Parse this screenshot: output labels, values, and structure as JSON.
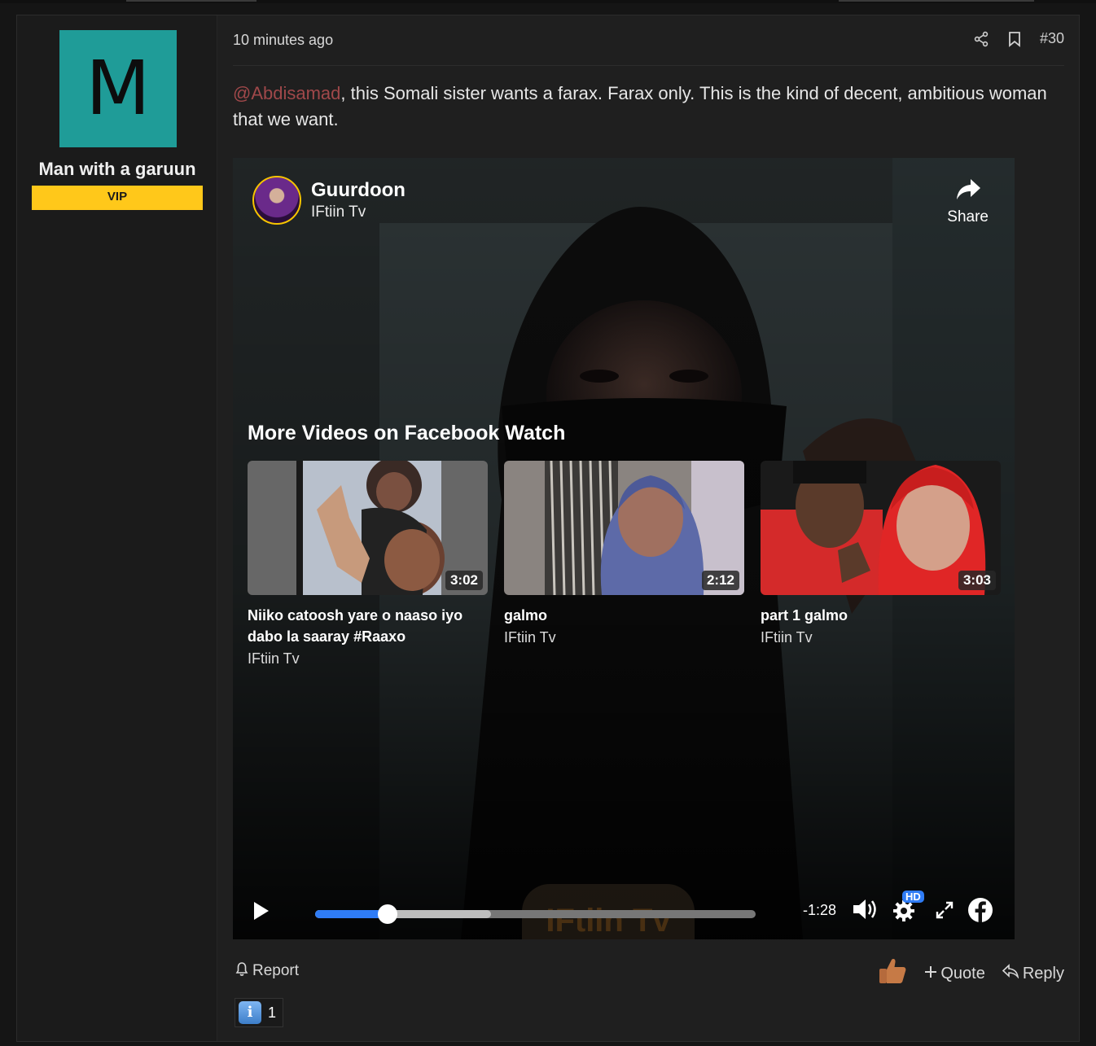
{
  "post": {
    "user": {
      "avatar_letter": "M",
      "name": "Man with a garuun",
      "badge": "VIP"
    },
    "timestamp": "10 minutes ago",
    "post_number": "#30",
    "message": {
      "mention": "@Abdisamad",
      "text": ", this Somali sister wants a farax. Farax only. This is the kind of decent, ambitious woman that we want."
    },
    "video": {
      "title": "Guurdoon",
      "page": "IFtiin Tv",
      "share_label": "Share",
      "more_videos_title": "More Videos on Facebook Watch",
      "suggested": [
        {
          "title": "Niiko catoosh yare o naaso iyo dabo la saaray #Raaxo",
          "channel": "IFtiin Tv",
          "duration": "3:02"
        },
        {
          "title": "galmo",
          "channel": "IFtiin Tv",
          "duration": "2:12"
        },
        {
          "title": "part 1 galmo",
          "channel": "IFtiin Tv",
          "duration": "3:03"
        }
      ],
      "time_remaining": "-1:28",
      "quality_badge": "HD",
      "watermark": "IFtiin Tv",
      "progress_played": 0.165,
      "progress_buffered": 0.4
    },
    "actions": {
      "report": "Report",
      "quote": "Quote",
      "reply": "Reply"
    },
    "reactions": {
      "info_icon": "i",
      "count": "1"
    }
  },
  "colors": {
    "avatar_bg": "#1f9c98",
    "badge_bg": "#ffc81a",
    "mention": "#a0484a",
    "progress": "#2f7cf6"
  }
}
